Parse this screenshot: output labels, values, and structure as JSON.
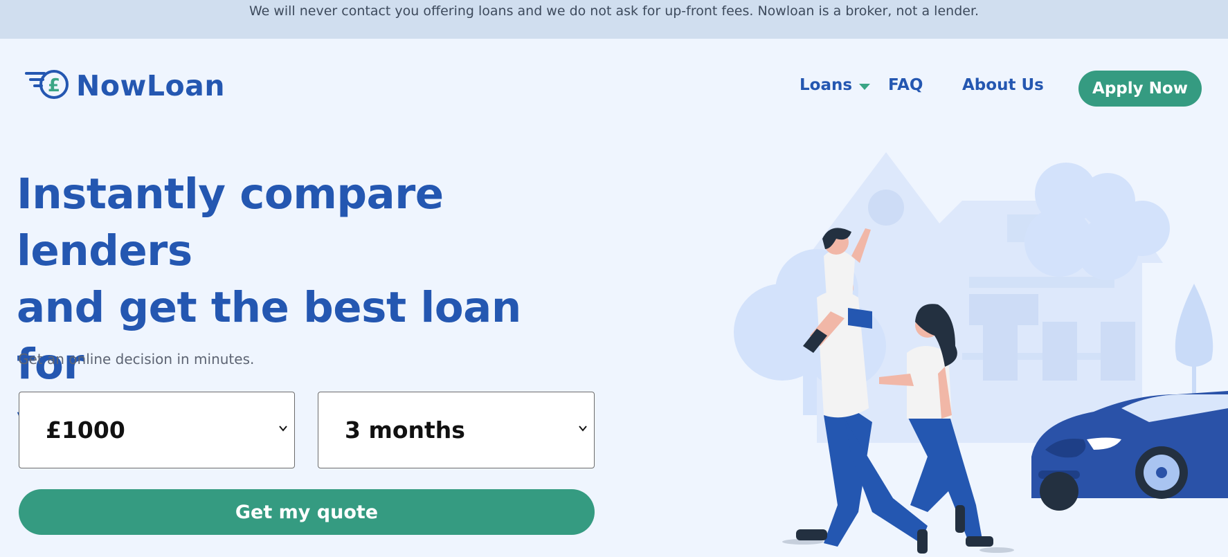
{
  "banner": {
    "text": "We will never contact you offering loans and we do not ask for up-front fees. Nowloan is a broker, not a lender."
  },
  "header": {
    "logo_text": "NowLoan",
    "logo_icon": "pound-coin-speed-icon",
    "nav": {
      "loans": "Loans",
      "faq": "FAQ",
      "about": "About Us"
    },
    "apply_label": "Apply Now"
  },
  "hero": {
    "headline_line1": "Instantly compare lenders",
    "headline_line2": "and get the best loan for",
    "headline_line3": "you",
    "subheadline": "Get an online decision in minutes.",
    "amount_select": {
      "selected": "£1000"
    },
    "term_select": {
      "selected": "3 months"
    },
    "quote_label": "Get my quote",
    "illustration": "family-house-car-illustration"
  },
  "colors": {
    "brand_blue": "#2457b1",
    "brand_green": "#359b81",
    "banner_bg": "#d0deef",
    "page_bg": "#eff5fe"
  }
}
